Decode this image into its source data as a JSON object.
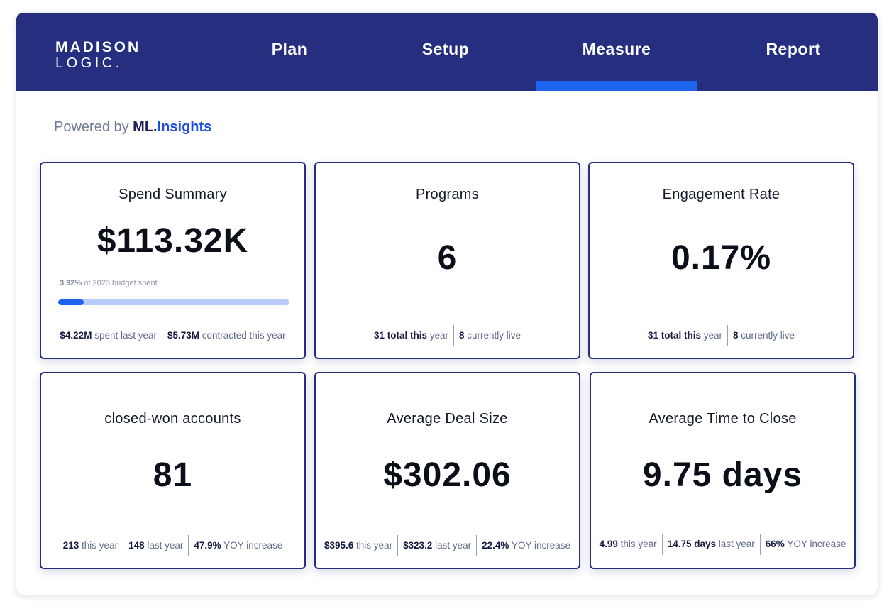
{
  "brand": {
    "line1": "MADISON",
    "line2": "LOGIC."
  },
  "nav": {
    "items": [
      {
        "label": "Plan"
      },
      {
        "label": "Setup"
      },
      {
        "label": "Measure",
        "active": true
      },
      {
        "label": "Report"
      }
    ]
  },
  "powered_by": {
    "prefix": "Powered by ",
    "brand_a": "ML.",
    "brand_b": "Insights"
  },
  "colors": {
    "nav_bg": "#262e80",
    "accent": "#1d64ee",
    "card_border": "#262e80"
  },
  "cards": {
    "spend": {
      "title": "Spend Summary",
      "value": "$113.32K",
      "budget_pct": "3.92%",
      "budget_text": " of 2023 budget spent",
      "budget_progress": 0.11,
      "stats": [
        {
          "bold": "$4.22M",
          "text": " spent last year"
        },
        {
          "bold": "$5.73M",
          "text": " contracted this year"
        }
      ]
    },
    "programs": {
      "title": "Programs",
      "value": "6",
      "stats": [
        {
          "bold": "31 total this",
          "text": " year"
        },
        {
          "bold": "8",
          "text": " currently live"
        }
      ]
    },
    "engagement": {
      "title": "Engagement Rate",
      "value": "0.17%",
      "stats": [
        {
          "bold": "31 total this",
          "text": " year"
        },
        {
          "bold": "8",
          "text": " currently live"
        }
      ]
    },
    "closed_won": {
      "title": "closed-won accounts",
      "value": "81",
      "stats": [
        {
          "bold": "213",
          "text": "  this year"
        },
        {
          "bold": "148",
          "text": " last year"
        },
        {
          "bold": "47.9%",
          "text": " YOY increase"
        }
      ]
    },
    "deal_size": {
      "title": "Average Deal Size",
      "value": "$302.06",
      "stats": [
        {
          "bold": "$395.6",
          "text": " this year"
        },
        {
          "bold": "$323.2",
          "text": " last year"
        },
        {
          "bold": "22.4%",
          "text": " YOY increase"
        }
      ]
    },
    "time_to_close": {
      "title": "Average Time to Close",
      "value": "9.75 days",
      "stats": [
        {
          "bold": "4.99",
          "text": " this year"
        },
        {
          "bold": "14.75 days",
          "text": " last year"
        },
        {
          "bold": "66%",
          "text": " YOY increase"
        }
      ]
    }
  }
}
